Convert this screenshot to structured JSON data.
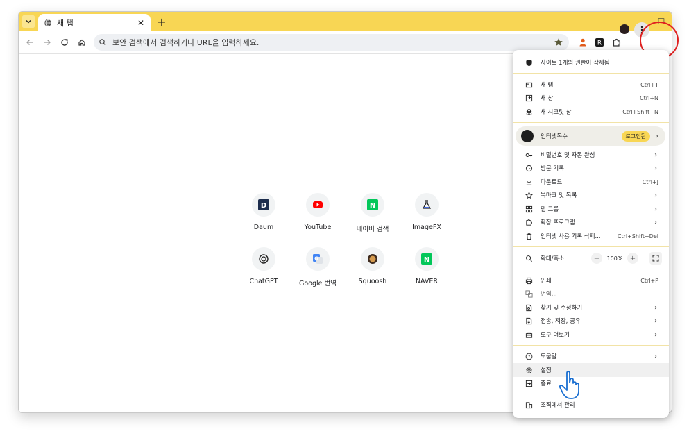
{
  "browser": {
    "tab_title": "새 탭",
    "omnibox_placeholder": "보안 검색에서 검색하거나 URL을 입력하세요."
  },
  "shortcuts": [
    {
      "label": "Daum"
    },
    {
      "label": "YouTube"
    },
    {
      "label": "네이버 검색"
    },
    {
      "label": "ImageFX"
    },
    {
      "label": "ChatGPT"
    },
    {
      "label": "Google 번역"
    },
    {
      "label": "Squoosh"
    },
    {
      "label": "NAVER"
    }
  ],
  "menu": {
    "site_permission": "사이트 1개의 권한이 삭제됨",
    "new_tab": {
      "label": "새 탭",
      "shortcut": "Ctrl+T"
    },
    "new_window": {
      "label": "새 창",
      "shortcut": "Ctrl+N"
    },
    "incognito": {
      "label": "새 시크릿 창",
      "shortcut": "Ctrl+Shift+N"
    },
    "profile": {
      "name": "인터넷목수",
      "badge": "로그인됨"
    },
    "passwords": {
      "label": "비밀번호 및 자동 완성"
    },
    "history": {
      "label": "방문 기록"
    },
    "downloads": {
      "label": "다운로드",
      "shortcut": "Ctrl+J"
    },
    "bookmarks": {
      "label": "북마크 및 목록"
    },
    "tab_groups": {
      "label": "탭 그룹"
    },
    "extensions": {
      "label": "확장 프로그램"
    },
    "clear_data": {
      "label": "인터넷 사용 기록 삭제...",
      "shortcut": "Ctrl+Shift+Del"
    },
    "zoom": {
      "label": "확대/축소",
      "minus": "−",
      "value": "100%",
      "plus": "+"
    },
    "print": {
      "label": "인쇄",
      "shortcut": "Ctrl+P"
    },
    "translate": {
      "label": "번역..."
    },
    "find_edit": {
      "label": "찾기 및 수정하기"
    },
    "cast_save_share": {
      "label": "전송, 저장, 공유"
    },
    "more_tools": {
      "label": "도구 더보기"
    },
    "help": {
      "label": "도움말"
    },
    "settings": {
      "label": "설정"
    },
    "exit": {
      "label": "종료"
    },
    "managed": {
      "label": "조직에서 관리"
    }
  }
}
